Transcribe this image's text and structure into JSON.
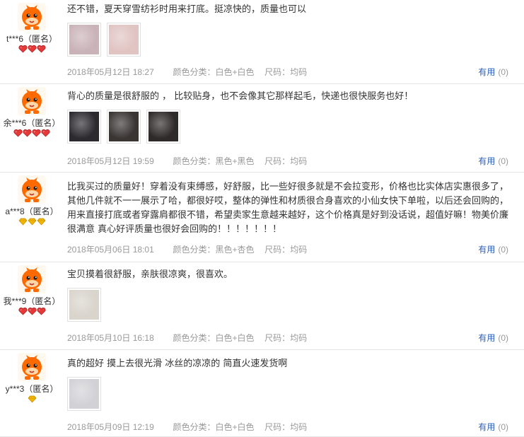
{
  "colors": {
    "link": "#2b5db5",
    "meta": "#999999",
    "avatar_orange": "#ff6a00",
    "gem_red": "#e63a3a",
    "gem_gold": "#f2b705"
  },
  "reviews": [
    {
      "user": "t***6（匿名）",
      "rank": {
        "type": "red-heart",
        "count": 3
      },
      "text": "还不错，夏天穿雪纺衫时用来打底。挺凉快的，质量也可以",
      "photos": [
        {
          "tone": "#c9b3b9"
        },
        {
          "tone": "#e0c4c2"
        }
      ],
      "date": "2018年05月12日 18:27",
      "color_label": "颜色分类：",
      "color_value": "白色+白色",
      "size_label": "尺码：",
      "size_value": "均码",
      "useful_label": "有用",
      "useful_count": "(0)"
    },
    {
      "user": "余***6（匿名）",
      "rank": {
        "type": "red-heart",
        "count": 4
      },
      "text": "背心的质量是很舒服的 ， 比较贴身，也不会像其它那样起毛，快递也很快服务也好！",
      "photos": [
        {
          "tone": "#2c2a2e"
        },
        {
          "tone": "#3a3533"
        },
        {
          "tone": "#2e2a2a"
        }
      ],
      "date": "2018年05月12日 19:59",
      "color_label": "颜色分类：",
      "color_value": "黑色+黑色",
      "size_label": "尺码：",
      "size_value": "均码",
      "useful_label": "有用",
      "useful_count": "(0)"
    },
    {
      "user": "a***8（匿名）",
      "rank": {
        "type": "gold-diamond",
        "count": 3
      },
      "text": "比我买过的质量好！穿着没有束缚感，好舒服，比一些好很多就是不会拉变形，价格也比实体店实惠很多了，其他几件就不一一展示了哈，都很好哎，整体的弹性和材质很合身喜欢的小仙女快下单啦，以后还会回购的，用来直接打底或者穿露肩都很不错，希望卖家生意越来越好，这个价格真是好到没话说，超值好嘛！物美价廉 很满意 真心好评质量也很好会回购的！！！！！！！",
      "photos": [],
      "date": "2018年05月06日 18:01",
      "color_label": "颜色分类：",
      "color_value": "黑色+杏色",
      "size_label": "尺码：",
      "size_value": "均码",
      "useful_label": "有用",
      "useful_count": "(0)"
    },
    {
      "user": "我***9（匿名）",
      "rank": {
        "type": "red-heart",
        "count": 3
      },
      "text": "宝贝摸着很舒服，亲肤很凉爽，很喜欢。",
      "photos": [
        {
          "tone": "#d9d4cc"
        }
      ],
      "date": "2018年05月10日 16:18",
      "color_label": "颜色分类：",
      "color_value": "白色+白色",
      "size_label": "尺码：",
      "size_value": "均码",
      "useful_label": "有用",
      "useful_count": "(0)"
    },
    {
      "user": "y***3（匿名）",
      "rank": {
        "type": "gold-diamond",
        "count": 1
      },
      "text": "真的超好 摸上去很光滑 冰丝的凉凉的 简直火速发货啊",
      "photos": [
        {
          "tone": "#d2d2d6"
        }
      ],
      "date": "2018年05月09日 12:19",
      "color_label": "颜色分类：",
      "color_value": "白色+白色",
      "size_label": "尺码：",
      "size_value": "均码",
      "useful_label": "有用",
      "useful_count": "(0)"
    }
  ]
}
